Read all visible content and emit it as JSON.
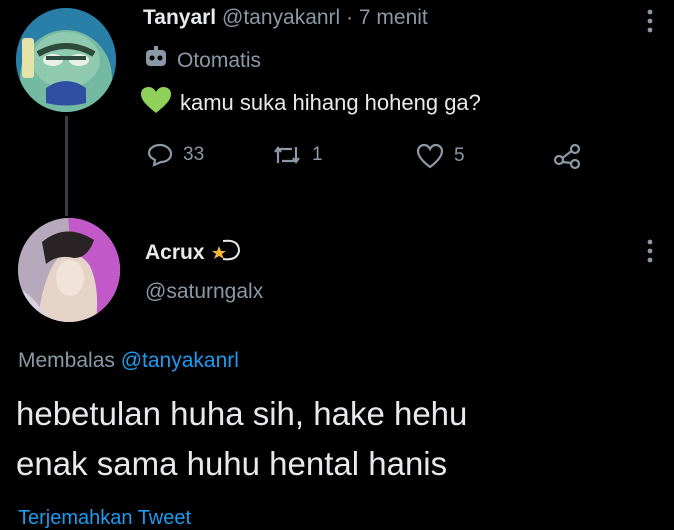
{
  "tweet": {
    "display_name": "Tanyarl",
    "handle": "@tanyakanrl",
    "separator": "·",
    "time": "7 menit",
    "automated_label": "Otomatis",
    "text": "kamu suka hihang hoheng ga?",
    "counts": {
      "replies": "33",
      "retweets": "1",
      "likes": "5"
    }
  },
  "reply": {
    "display_name": "Acrux",
    "handle": "@saturngalx",
    "replying_prefix": "Membalas",
    "replying_to": "@tanyakanrl",
    "text_line1": "hebetulan huha sih, hake hehu",
    "text_line2": "enak sama huhu hental hanis",
    "translate_label": "Terjemahkan Tweet"
  },
  "colors": {
    "background": "#000000",
    "text": "#e7e9ea",
    "muted": "#71767b",
    "link": "#1d9bf0",
    "heart_green": "#8fd15b"
  },
  "icons": [
    "more-icon",
    "robot-icon",
    "green-heart-icon",
    "reply-icon",
    "retweet-icon",
    "like-icon",
    "share-icon",
    "shooting-star-icon"
  ]
}
